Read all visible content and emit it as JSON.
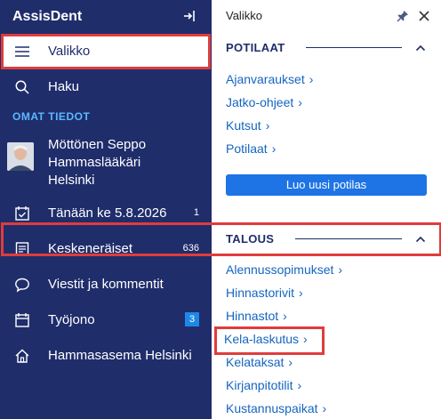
{
  "sidebar": {
    "brand": "AssisDent",
    "menu_label": "Valikko",
    "search_label": "Haku",
    "section_title": "OMAT TIEDOT",
    "user": {
      "name": "Möttönen Seppo",
      "role": "Hammaslääkäri",
      "city": "Helsinki"
    },
    "items": [
      {
        "label": "Tänään ke 5.8.2026",
        "count": "1"
      },
      {
        "label": "Keskeneräiset",
        "count": "636"
      },
      {
        "label": "Viestit ja kommentit",
        "count": ""
      },
      {
        "label": "Työjono",
        "count": "3"
      },
      {
        "label": "Hammasasema Helsinki",
        "count": ""
      }
    ]
  },
  "panel": {
    "title": "Valikko",
    "groups": [
      {
        "title": "POTILAAT",
        "links": [
          "Ajanvaraukset",
          "Jatko-ohjeet",
          "Kutsut",
          "Potilaat"
        ],
        "button": "Luo uusi potilas"
      },
      {
        "title": "TALOUS",
        "links": [
          "Alennussopimukset",
          "Hinnastorivit",
          "Hinnastot",
          "Kela-laskutus",
          "Kelataksat",
          "Kirjanpitotilit",
          "Kustannuspaikat"
        ]
      }
    ],
    "link_arrow": "›"
  },
  "colors": {
    "sidebar_bg": "#1f2d6b",
    "accent": "#1e74e4",
    "highlight": "#e03c3c",
    "link": "#1565c0"
  }
}
